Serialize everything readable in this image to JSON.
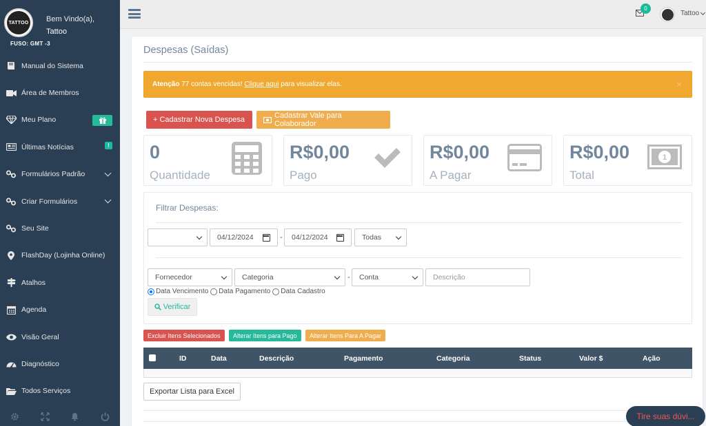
{
  "sidebar": {
    "logo_text": "TATTOO",
    "welcome": "Bem Vindo(a),",
    "username": "Tattoo",
    "fuso": "FUSO: GMT -3",
    "items": [
      {
        "label": "Manual do Sistema",
        "icon": "book-icon"
      },
      {
        "label": "Área de Membros",
        "icon": "video-icon"
      },
      {
        "label": "Meu Plano",
        "icon": "diamond-icon"
      },
      {
        "label": "Últimas Notícias",
        "icon": "newspaper-icon"
      },
      {
        "label": "Formulários Padrão",
        "icon": "link-icon"
      },
      {
        "label": "Criar Formulários",
        "icon": "link-icon"
      },
      {
        "label": "Seu Site",
        "icon": "link-icon"
      },
      {
        "label": "FlashDay (Lojinha Online)",
        "icon": "map-marker-icon"
      },
      {
        "label": "Atalhos",
        "icon": "signpost-icon"
      },
      {
        "label": "Agenda",
        "icon": "calendar-icon"
      },
      {
        "label": "Visão Geral",
        "icon": "eye-icon"
      },
      {
        "label": "Diagnóstico",
        "icon": "dashboard-icon"
      },
      {
        "label": "Todos Serviços",
        "icon": "folder-icon"
      }
    ],
    "news_badge": "!",
    "footer_icons": [
      "gear-icon",
      "fullscreen-icon",
      "bell-icon",
      "power-icon"
    ]
  },
  "topbar": {
    "mail_count": "0",
    "user": "Tattoo"
  },
  "page": {
    "title": "Despesas (Saídas)",
    "alert": {
      "prefix": "Atenção",
      "count_text": "77 contas vencidas!",
      "link": "Clique aqui",
      "suffix": "para visualizar elas.",
      "close": "×"
    },
    "btn_new_expense": "+ Cadastrar Nova Despesa",
    "btn_voucher": "Cadastrar Vale para Colaborador",
    "stats": [
      {
        "value": "0",
        "label": "Quantidade",
        "icon": "calculator-icon"
      },
      {
        "value": "R$0,00",
        "label": "Pago",
        "icon": "check-icon"
      },
      {
        "value": "R$0,00",
        "label": "A Pagar",
        "icon": "credit-card-icon"
      },
      {
        "value": "R$0,00",
        "label": "Total",
        "icon": "money-icon"
      }
    ]
  },
  "filter": {
    "title": "Filtrar Despesas:",
    "select_empty": "",
    "date_from": "04/12/2024",
    "date_to": "04/12/2024",
    "status": "Todas",
    "supplier": "Fornecedor",
    "category": "Categoria",
    "account": "Conta",
    "description_placeholder": "Descrição",
    "radio_due": "Data Vencimento",
    "radio_payment": "Data Pagamento",
    "radio_register": "Data Cadastro",
    "verify": "Verificar",
    "dash": "-"
  },
  "actions": {
    "delete": "Excluir Itens Selecionados",
    "to_paid": "Alterar Itens para Pago",
    "to_pay": "Alterar Itens Para A Pagar"
  },
  "table": {
    "columns": [
      "ID",
      "Data",
      "Descrição",
      "Pagamento",
      "Categoria",
      "Status",
      "Valor $",
      "Ação"
    ]
  },
  "export": "Exportar Lista para Excel",
  "chat": "Tire suas dúvi..."
}
